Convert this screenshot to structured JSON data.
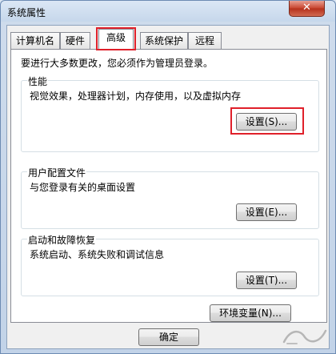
{
  "window": {
    "title": "系统属性",
    "close_glyph": "✕"
  },
  "tabs": [
    {
      "label": "计算机名"
    },
    {
      "label": "硬件"
    },
    {
      "label": "高级",
      "active": true
    },
    {
      "label": "系统保护"
    },
    {
      "label": "远程"
    }
  ],
  "admin_note": "要进行大多数更改，您必须作为管理员登录。",
  "performance": {
    "title": "性能",
    "description": "视觉效果，处理器计划，内存使用，以及虚拟内存",
    "button": "设置(S)..."
  },
  "user_profiles": {
    "title": "用户配置文件",
    "description": "与您登录有关的桌面设置",
    "button": "设置(E)..."
  },
  "startup_recovery": {
    "title": "启动和故障恢复",
    "description": "系统启动、系统失败和调试信息",
    "button": "设置(T)..."
  },
  "env_button": "环境变量(N)...",
  "ok_button": "确定",
  "highlight_color": "#e0202a"
}
